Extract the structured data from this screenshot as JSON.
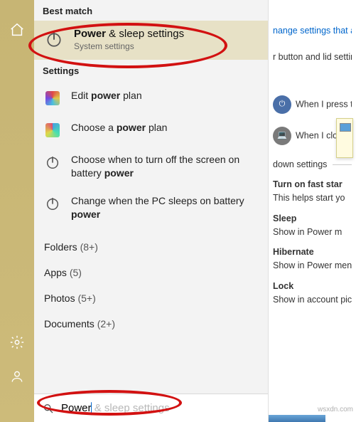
{
  "section_labels": {
    "best_match": "Best match",
    "settings": "Settings"
  },
  "best_match": {
    "title_bold": "Power",
    "title_rest": " & sleep settings",
    "subtitle": "System settings"
  },
  "settings_results": [
    {
      "icon": "color",
      "pre": "Edit ",
      "bold": "power",
      "post": " plan"
    },
    {
      "icon": "color2",
      "pre": "Choose a ",
      "bold": "power",
      "post": " plan"
    },
    {
      "icon": "power",
      "pre": "Choose when to turn off the screen on battery ",
      "bold": "power",
      "post": ""
    },
    {
      "icon": "power",
      "pre": "Change when the PC sleeps on battery ",
      "bold": "power",
      "post": ""
    }
  ],
  "folders": [
    {
      "label": "Folders",
      "count": "(8+)"
    },
    {
      "label": "Apps",
      "count": "(5)"
    },
    {
      "label": "Photos",
      "count": "(5+)"
    },
    {
      "label": "Documents",
      "count": "(2+)"
    }
  ],
  "search": {
    "typed": "Power",
    "suggestion_rest": " & sleep settings",
    "placeholder": "Search"
  },
  "background": {
    "link1": "nange settings that are",
    "sub1": "r button and lid settin",
    "row1": "When I press the p",
    "row2": "When I close",
    "shutdown_hdr": "down settings",
    "items": [
      {
        "t1": "Turn on fast star",
        "t2": "This helps start yo"
      },
      {
        "t1": "Sleep",
        "t2": "Show in Power m"
      },
      {
        "t1": "Hibernate",
        "t2": "Show in Power menu."
      },
      {
        "t1": "Lock",
        "t2": "Show in account pictu"
      }
    ]
  },
  "watermark": "wsxdn.com"
}
